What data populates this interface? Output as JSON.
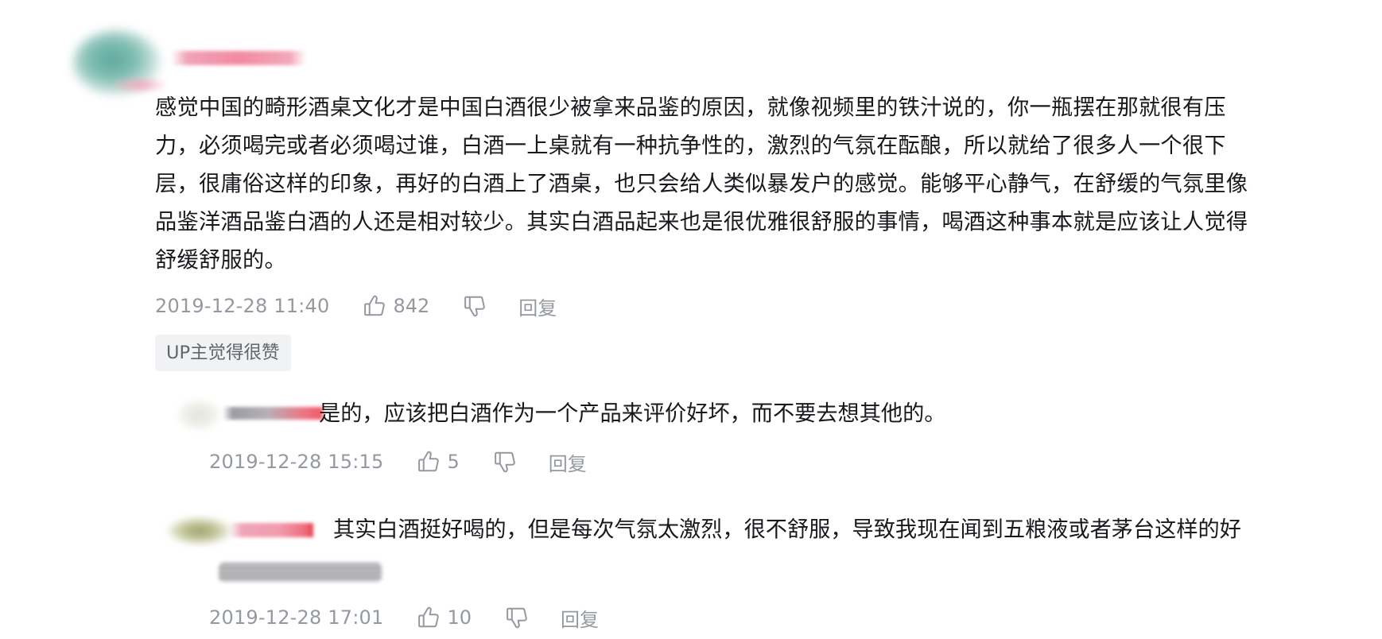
{
  "main_comment": {
    "text_lines": [
      "感觉中国的畸形酒桌文化才是中国白酒很少被拿来品鉴的原因，就像视频里的铁汁说的，你一瓶摆在那就很有压",
      "力，必须喝完或者必须喝过谁，白酒一上桌就有一种抗争性的，激烈的气氛在酝酿，所以就给了很多人一个很下",
      "层，很庸俗这样的印象，再好的白酒上了酒桌，也只会给人类似暴发户的感觉。能够平心静气，在舒缓的气氛里像",
      "品鉴洋酒品鉴白酒的人还是相对较少。其实白酒品起来也是很优雅很舒服的事情，喝酒这种事本就是应该让人觉得",
      "舒缓舒服的。"
    ],
    "time": "2019-12-28 11:40",
    "like_count": "842",
    "reply_label": "回复",
    "up_tag": "UP主觉得很赞",
    "like_icon": "thumbs-up-icon",
    "dislike_icon": "thumbs-down-icon"
  },
  "replies": [
    {
      "text": "是的，应该把白酒作为一个产品来评价好坏，而不要去想其他的。",
      "time": "2019-12-28 15:15",
      "like_count": "5",
      "reply_label": "回复"
    },
    {
      "text": "其实白酒挺好喝的，但是每次气氛太激烈，很不舒服，导致我现在闻到五粮液或者茅台这样的好",
      "time": "2019-12-28 17:01",
      "like_count": "10",
      "reply_label": "回复"
    }
  ],
  "colors": {
    "text": "#18191c",
    "meta": "#9499a0",
    "tag_bg": "#f1f2f3",
    "tag_text": "#61666d"
  }
}
